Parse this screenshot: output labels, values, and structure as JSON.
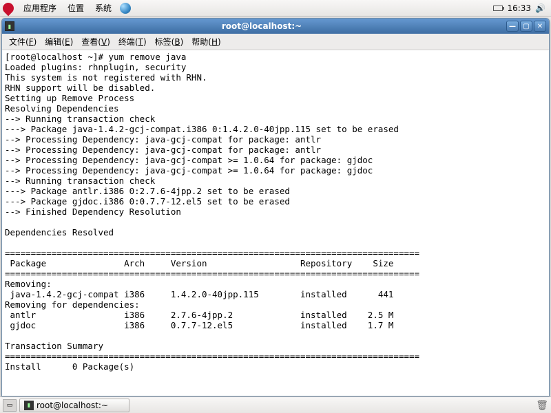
{
  "top_panel": {
    "menus": [
      "应用程序",
      "位置",
      "系统"
    ],
    "time": "16:33"
  },
  "window": {
    "title": "root@localhost:~",
    "menubar": [
      {
        "label": "文件",
        "accel": "F"
      },
      {
        "label": "编辑",
        "accel": "E"
      },
      {
        "label": "查看",
        "accel": "V"
      },
      {
        "label": "终端",
        "accel": "T"
      },
      {
        "label": "标签",
        "accel": "B"
      },
      {
        "label": "帮助",
        "accel": "H"
      }
    ]
  },
  "terminal": {
    "prompt": "[root@localhost ~]# ",
    "command": "yum remove java",
    "lines": [
      "Loaded plugins: rhnplugin, security",
      "This system is not registered with RHN.",
      "RHN support will be disabled.",
      "Setting up Remove Process",
      "Resolving Dependencies",
      "--> Running transaction check",
      "---> Package java-1.4.2-gcj-compat.i386 0:1.4.2.0-40jpp.115 set to be erased",
      "--> Processing Dependency: java-gcj-compat for package: antlr",
      "--> Processing Dependency: java-gcj-compat for package: antlr",
      "--> Processing Dependency: java-gcj-compat >= 1.0.64 for package: gjdoc",
      "--> Processing Dependency: java-gcj-compat >= 1.0.64 for package: gjdoc",
      "--> Running transaction check",
      "---> Package antlr.i386 0:2.7.6-4jpp.2 set to be erased",
      "---> Package gjdoc.i386 0:0.7.7-12.el5 set to be erased",
      "--> Finished Dependency Resolution",
      "",
      "Dependencies Resolved",
      ""
    ],
    "separator": "================================================================================",
    "table_header": {
      "col1": "Package",
      "col2": "Arch",
      "col3": "Version",
      "col4": "Repository",
      "col5": "Size"
    },
    "removing_label": "Removing:",
    "removing_deps_label": "Removing for dependencies:",
    "rows": [
      {
        "pkg": "java-1.4.2-gcj-compat",
        "arch": "i386",
        "ver": "1.4.2.0-40jpp.115",
        "repo": "installed",
        "size": "441"
      },
      {
        "pkg": "antlr",
        "arch": "i386",
        "ver": "2.7.6-4jpp.2",
        "repo": "installed",
        "size": "2.5 M"
      },
      {
        "pkg": "gjdoc",
        "arch": "i386",
        "ver": "0.7.7-12.el5",
        "repo": "installed",
        "size": "1.7 M"
      }
    ],
    "summary_label": "Transaction Summary",
    "install_line": "Install      0 Package(s)"
  },
  "taskbar": {
    "task_label": "root@localhost:~"
  }
}
